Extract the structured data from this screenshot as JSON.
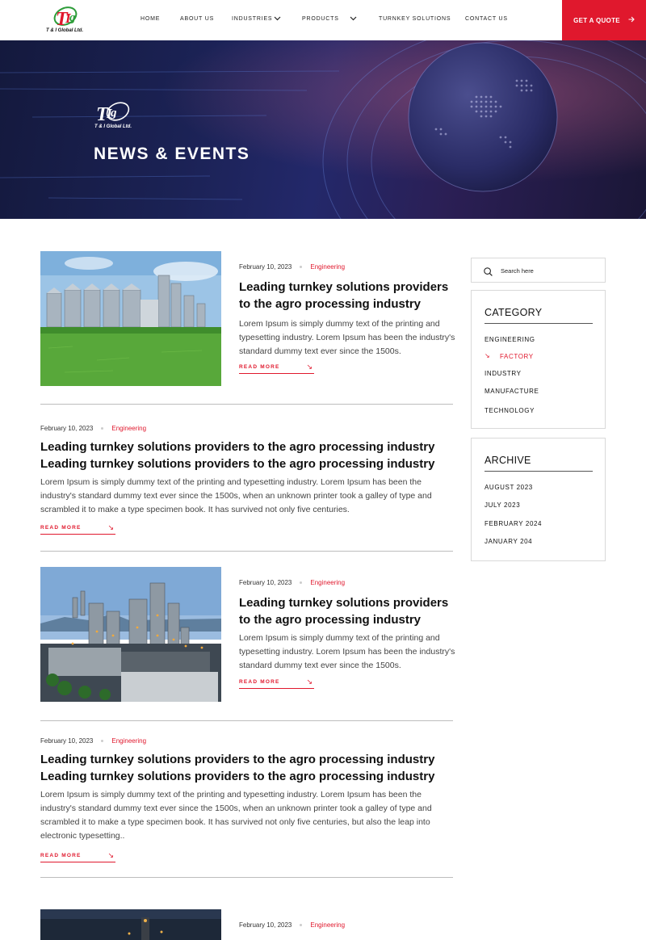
{
  "brand": {
    "logo_text": "T & I Global Ltd.",
    "accent": "#e0182d"
  },
  "nav": {
    "items": [
      {
        "label": "HOME"
      },
      {
        "label": "ABOUT US"
      },
      {
        "label": "INDUSTRIES"
      },
      {
        "label": "PRODUCTS"
      },
      {
        "label": "TURNKEY SOLUTIONS"
      },
      {
        "label": "CONTACT US"
      }
    ],
    "cta_label": "GET A QUOTE"
  },
  "hero": {
    "title": "NEWS & EVENTS",
    "logo_text": "T & I Global Ltd."
  },
  "posts": [
    {
      "date": "February 10, 2023",
      "category": "Engineering",
      "title": "Leading turnkey solutions providers to the agro processing industry",
      "excerpt": "Lorem Ipsum is simply dummy text of the printing and typesetting industry. Lorem Ipsum has been the industry's standard dummy text ever since the 1500s.",
      "read_more": "READ MORE"
    },
    {
      "date": "February 10, 2023",
      "category": "Engineering",
      "title": "Leading turnkey solutions providers to the agro processing industry Leading turnkey solutions providers to the agro processing industry",
      "excerpt": "Lorem Ipsum is simply dummy text of the printing and typesetting industry. Lorem Ipsum has been the industry's standard dummy text ever since the 1500s, when an unknown printer took a galley of type and scrambled it to make a type specimen book. It has survived not only five centuries.",
      "read_more": "READ MORE"
    },
    {
      "date": "February 10, 2023",
      "category": "Engineering",
      "title": "Leading turnkey solutions providers to the agro processing industry",
      "excerpt": "Lorem Ipsum is simply dummy text of the printing and typesetting industry. Lorem Ipsum has been the industry's standard dummy text ever since the 1500s.",
      "read_more": "READ MORE"
    },
    {
      "date": "February 10, 2023",
      "category": "Engineering",
      "title": "Leading turnkey solutions providers to the agro processing industry Leading turnkey solutions providers to the agro processing industry",
      "excerpt": "Lorem Ipsum is simply dummy text of the printing and typesetting industry. Lorem Ipsum has been the industry's standard dummy text ever since the 1500s, when an unknown printer took a galley of type and scrambled it to make a type specimen book. It has survived not only five centuries, but also the leap into electronic typesetting..",
      "read_more": "READ MORE"
    },
    {
      "date": "February 10, 2023",
      "category": "Engineering"
    }
  ],
  "sidebar": {
    "search_placeholder": "Search here",
    "category": {
      "title": "CATEGORY",
      "items": [
        {
          "label": "ENGINEERING"
        },
        {
          "label": "FACTORY"
        },
        {
          "label": "INDUSTRY"
        },
        {
          "label": "MANUFACTURE"
        },
        {
          "label": "TECHNOLOGY"
        }
      ]
    },
    "archive": {
      "title": "ARCHIVE",
      "items": [
        {
          "label": "AUGUST 2023"
        },
        {
          "label": "JULY 2023"
        },
        {
          "label": "FEBRUARY 2024"
        },
        {
          "label": "JANUARY 204"
        }
      ]
    }
  }
}
